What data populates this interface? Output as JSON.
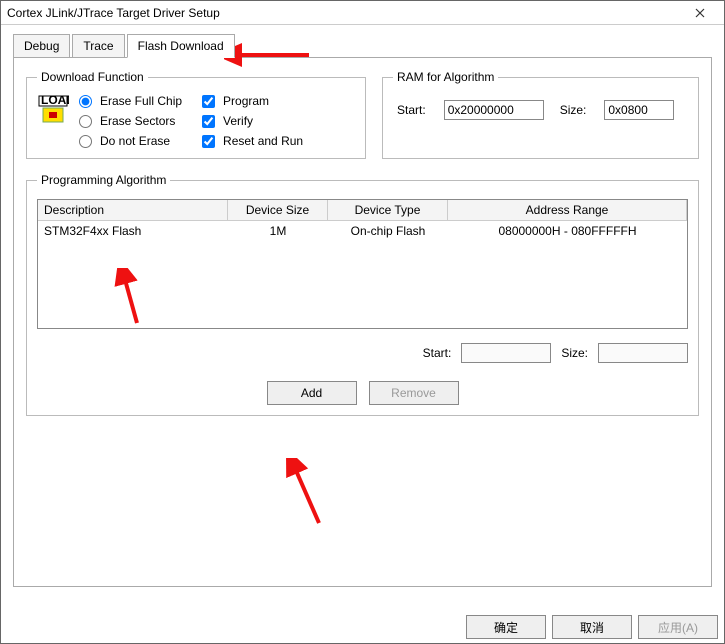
{
  "window": {
    "title": "Cortex JLink/JTrace Target Driver Setup"
  },
  "tabs": {
    "debug": "Debug",
    "trace": "Trace",
    "flash": "Flash Download",
    "active": "flash"
  },
  "download_function": {
    "legend": "Download Function",
    "radios": {
      "erase_full": "Erase Full Chip",
      "erase_sectors": "Erase Sectors",
      "do_not_erase": "Do not Erase",
      "selected": "erase_full"
    },
    "checks": {
      "program": {
        "label": "Program",
        "checked": true
      },
      "verify": {
        "label": "Verify",
        "checked": true
      },
      "reset_run": {
        "label": "Reset and Run",
        "checked": true
      }
    }
  },
  "ram": {
    "legend": "RAM for Algorithm",
    "start_label": "Start:",
    "start_value": "0x20000000",
    "size_label": "Size:",
    "size_value": "0x0800"
  },
  "prog_alg": {
    "legend": "Programming Algorithm",
    "columns": {
      "desc": "Description",
      "size": "Device Size",
      "type": "Device Type",
      "addr": "Address Range"
    },
    "rows": [
      {
        "desc": "STM32F4xx Flash",
        "size": "1M",
        "type": "On-chip Flash",
        "addr": "08000000H - 080FFFFFH"
      }
    ],
    "start_label": "Start:",
    "start_value": "",
    "size_label": "Size:",
    "size_value": "",
    "add": "Add",
    "remove": "Remove"
  },
  "footer": {
    "ok": "确定",
    "cancel": "取消",
    "apply": "应用(A)"
  }
}
